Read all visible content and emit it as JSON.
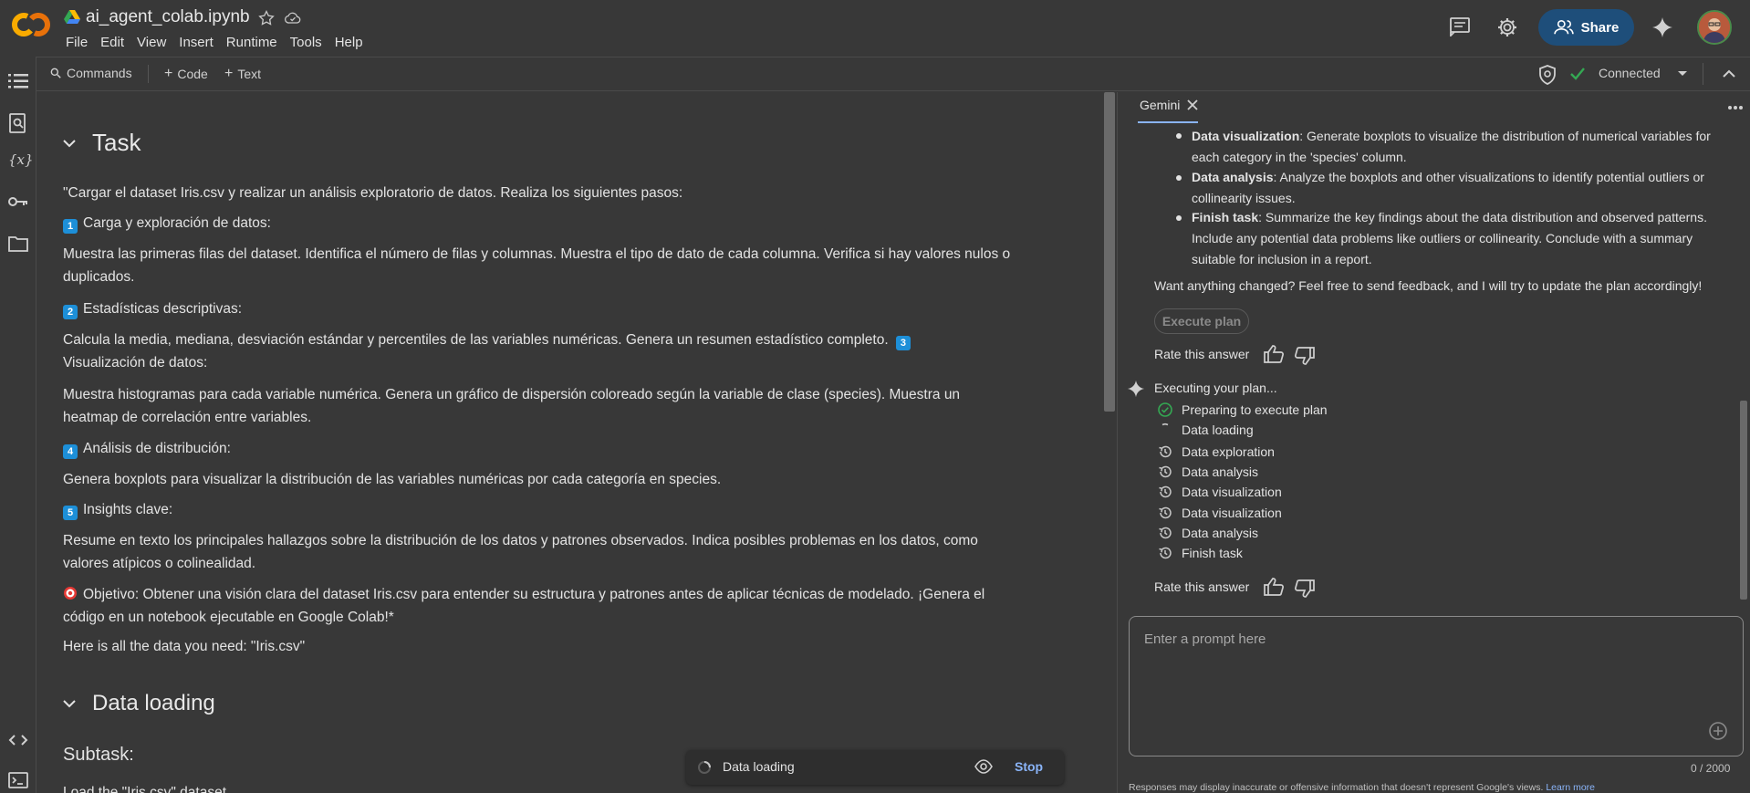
{
  "header": {
    "filename": "ai_agent_colab.ipynb",
    "menu": [
      "File",
      "Edit",
      "View",
      "Insert",
      "Runtime",
      "Tools",
      "Help"
    ],
    "share_label": "Share"
  },
  "toolbar": {
    "commands": "Commands",
    "code": "Code",
    "text": "Text",
    "connection": "Connected"
  },
  "notebook": {
    "sections": {
      "task": "Task",
      "data_loading": "Data loading"
    },
    "paragraphs": {
      "intro": "\"Cargar el dataset Iris.csv y realizar un análisis exploratorio de datos. Realiza los siguientes pasos:",
      "step1_badge": "1",
      "step1": "Carga y exploración de datos:",
      "step1_body": "Muestra las primeras filas del dataset. Identifica el número de filas y columnas. Muestra el tipo de dato de cada columna. Verifica si hay valores nulos o duplicados.",
      "step2_badge": "2",
      "step2": "Estadísticas descriptivas:",
      "step2_body_a": "Calcula la media, mediana, desviación estándar y percentiles de las variables numéricas. Genera un resumen estadístico completo.",
      "step3_badge": "3",
      "step3_inline": "Visualización de datos:",
      "step3_body": "Muestra histogramas para cada variable numérica. Genera un gráfico de dispersión coloreado según la variable de clase (species). Muestra un heatmap de correlación entre variables.",
      "step4_badge": "4",
      "step4": "Análisis de distribución:",
      "step4_body": "Genera boxplots para visualizar la distribución de las variables numéricas por cada categoría en species.",
      "step5_badge": "5",
      "step5": "Insights clave:",
      "step5_body": "Resume en texto los principales hallazgos sobre la distribución de los datos y patrones observados. Indica posibles problemas en los datos, como valores atípicos o colinealidad.",
      "objective": "Objetivo: Obtener una visión clara del dataset Iris.csv para entender su estructura y patrones antes de aplicar técnicas de modelado. ¡Genera el código en un notebook ejecutable en Google Colab!*",
      "data_needed": "Here is all the data you need: \"Iris.csv\"",
      "subtask": "Subtask:",
      "load_text": "Load the \"Iris.csv\" dataset."
    },
    "status": {
      "label": "Data loading",
      "stop": "Stop"
    }
  },
  "gemini": {
    "tab": "Gemini",
    "bullets": [
      {
        "bold": "Data visualization",
        "text": ": Generate boxplots to visualize the distribution of numerical variables for each category in the 'species' column."
      },
      {
        "bold": "Data analysis",
        "text": ": Analyze the boxplots and other visualizations to identify potential outliers or collinearity issues."
      },
      {
        "bold": "Finish task",
        "text": ": Summarize the key findings about the data distribution and observed patterns. Include any potential data problems like outliers or collinearity. Conclude with a summary suitable for inclusion in a report."
      }
    ],
    "feedback_text": "Want anything changed? Feel free to send feedback, and I will try to update the plan accordingly!",
    "execute_plan": "Execute plan",
    "rate": "Rate this answer",
    "executing": "Executing your plan...",
    "steps": [
      {
        "label": "Preparing to execute plan",
        "status": "done"
      },
      {
        "label": "Data loading",
        "status": "running"
      },
      {
        "label": "Data exploration",
        "status": "pending"
      },
      {
        "label": "Data analysis",
        "status": "pending"
      },
      {
        "label": "Data visualization",
        "status": "pending"
      },
      {
        "label": "Data visualization",
        "status": "pending"
      },
      {
        "label": "Data analysis",
        "status": "pending"
      },
      {
        "label": "Finish task",
        "status": "pending"
      }
    ],
    "rate2": "Rate this answer",
    "prompt_placeholder": "Enter a prompt here",
    "counter": "0 / 2000",
    "disclaimer": "Responses may display inaccurate or offensive information that doesn't represent Google's views.",
    "learn_more": "Learn more"
  },
  "colors": {
    "background": "#383838",
    "accent_blue": "#8ab4f8",
    "share_bg": "#1e4e7a",
    "check_green": "#34a853",
    "logo_orange": "#f9ab00"
  }
}
